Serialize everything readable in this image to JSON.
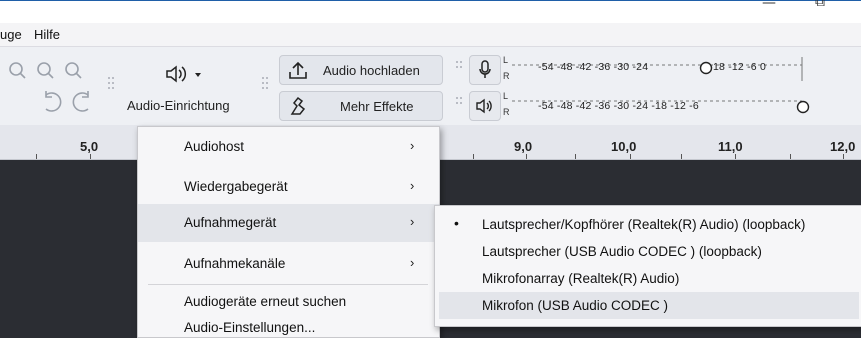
{
  "window": {
    "minimize_glyph": "—",
    "maximize_glyph": "⧉"
  },
  "menubar": {
    "items": [
      "uge",
      "Hilfe"
    ]
  },
  "toolbar": {
    "audio_setup_label": "Audio-Einrichtung",
    "audio_setup_icon": "speaker-icon",
    "share_audio_label": "Audio hochladen",
    "more_effects_label": "Mehr Effekte",
    "meter_scale_record": "-54  -48  -42  -36  -30  -24",
    "meter_scale_record_tail": "18  -12   -6   0",
    "meter_scale_play": "-54  -48  -42  -36  -30  -24  -18  -12   -6",
    "meter_l": "L",
    "meter_r": "R"
  },
  "ruler": {
    "labels": [
      "5,0",
      "9,0",
      "10,0",
      "11,0",
      "12,0"
    ]
  },
  "audio_menu": {
    "items": [
      {
        "label": "Audiohost",
        "has_submenu": true
      },
      {
        "label": "Wiedergabegerät",
        "has_submenu": true
      },
      {
        "label": "Aufnahmegerät",
        "has_submenu": true,
        "highlighted": true
      },
      {
        "label": "Aufnahmekanäle",
        "has_submenu": true
      },
      {
        "label": "Audiogeräte erneut suchen",
        "has_submenu": false
      },
      {
        "label": "Audio-Einstellungen...",
        "has_submenu": false
      }
    ],
    "arrow_glyph": "›"
  },
  "recording_device_submenu": {
    "bullet": "•",
    "items": [
      {
        "label": "Lautsprecher/Kopfhörer (Realtek(R) Audio) (loopback)",
        "selected": true
      },
      {
        "label": "Lautsprecher (USB Audio CODEC ) (loopback)",
        "selected": false
      },
      {
        "label": "Mikrofonarray (Realtek(R) Audio)",
        "selected": false
      },
      {
        "label": "Mikrofon (USB Audio CODEC )",
        "selected": false,
        "highlighted": true
      }
    ]
  },
  "colors": {
    "accent_border": "#1f5fa8",
    "track_bg": "#2b2d33",
    "menu_bg": "#f6f6f8",
    "highlight": "#e3e5ea"
  }
}
